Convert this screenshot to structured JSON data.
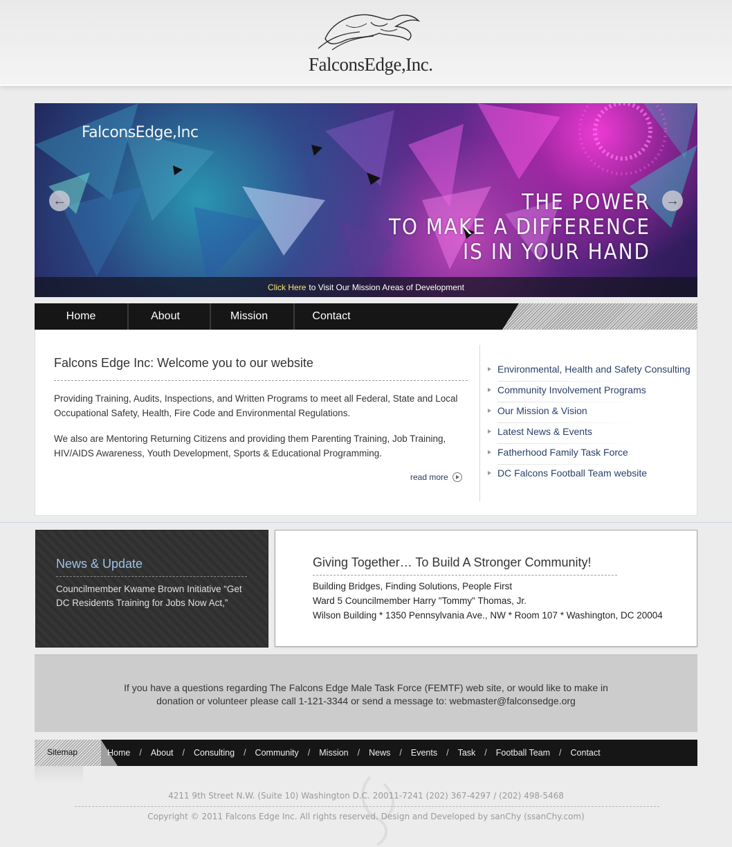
{
  "header": {
    "logo_text": "FalconsEdge,Inc."
  },
  "slider": {
    "brand": "FalconsEdge,Inc",
    "tagline": [
      "THE POWER",
      "TO MAKE A DIFFERENCE",
      "IS IN YOUR HAND"
    ],
    "caption_link": "Click Here",
    "caption_text": "to Visit Our Mission Areas of Development",
    "prev_icon": "arrow-left-icon",
    "next_icon": "arrow-right-icon"
  },
  "nav": {
    "items": [
      "Home",
      "About",
      "Mission",
      "Contact"
    ]
  },
  "welcome": {
    "title": "Falcons Edge Inc: Welcome you to our website",
    "para1": "Providing Training, Audits, Inspections, and Written Programs to meet all Federal, State and Local Occupational Safety, Health, Fire Code and Environmental Regulations.",
    "para2": "We also are Mentoring Returning Citizens and providing them Parenting Training, Job Training,  HIV/AIDS Awareness, Youth Development, Sports & Educational Programming.",
    "read_more": "read more"
  },
  "side_links": [
    "Environmental, Health and Safety Consulting",
    "Community Involvement Programs",
    "Our Mission & Vision",
    "Latest News & Events",
    "Fatherhood Family Task Force",
    "DC Falcons Football Team website"
  ],
  "news": {
    "title": "News & Update",
    "text": "Councilmember Kwame Brown Initiative “Get DC Residents Training for Jobs Now Act,”"
  },
  "giving": {
    "title": "Giving Together… To Build A Stronger Community!",
    "lines": [
      "Building Bridges, Finding Solutions, People First",
      "Ward 5 Councilmember Harry \"Tommy\" Thomas, Jr.",
      "Wilson Building * 1350 Pennsylvania Ave., NW * Room 107 * Washington, DC  20004"
    ]
  },
  "contact": {
    "line1": "If you have a questions regarding The Falcons Edge Male Task Force (FEMTF) web site, or would like to make in",
    "line2": "donation or volunteer please call 1-121-3344 or send a message to: webmaster@falconsedge.org"
  },
  "sitemap": {
    "label": "Sitemap",
    "separator": "/",
    "links": [
      "Home",
      "About",
      "Consulting",
      "Community",
      "Mission",
      "News",
      "Events",
      "Task",
      "Football Team",
      "Contact"
    ]
  },
  "footer": {
    "address": "4211 9th Street N.W. (Suite 10) Washington D.C. 20011-7241 (202) 367-4297 / (202) 498-5468",
    "copyright": "Copyright © 2011 Falcons Edge Inc. All rights reserved. Design and Developed by sanChy (ssanChy.com)"
  }
}
